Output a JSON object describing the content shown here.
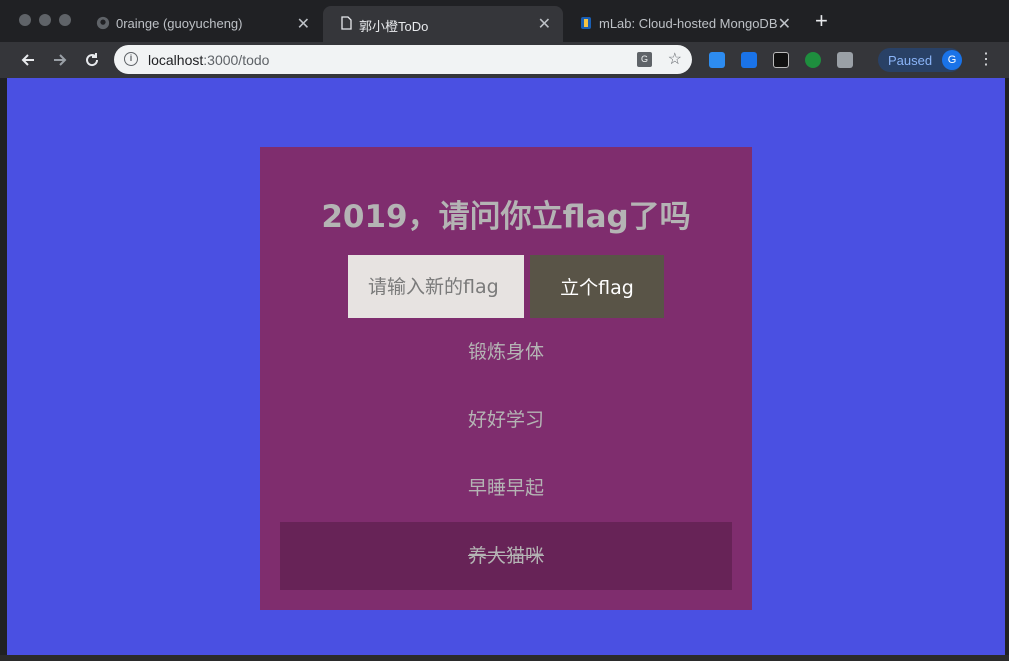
{
  "browser": {
    "tabs": [
      {
        "title": "0rainge (guoyucheng)",
        "active": false,
        "favicon": "github-icon"
      },
      {
        "title": "郭小橙ToDo",
        "active": true,
        "favicon": "document-icon"
      },
      {
        "title": "mLab: Cloud-hosted MongoDB",
        "active": false,
        "favicon": "mlab-icon"
      }
    ],
    "close_glyph": "✕",
    "new_tab_glyph": "+",
    "url_host": "localhost",
    "url_path": ":3000/todo",
    "profile_status": "Paused",
    "profile_initial": "G"
  },
  "page": {
    "heading": "2019，请问你立flag了吗",
    "input_placeholder": "请输入新的flag",
    "add_button": "立个flag",
    "todos": [
      {
        "text": "锻炼身体",
        "done": false
      },
      {
        "text": "好好学习",
        "done": false
      },
      {
        "text": "早睡早起",
        "done": false
      },
      {
        "text": "养大猫咪",
        "done": true
      }
    ]
  },
  "colors": {
    "page_background": "#4a50e2",
    "card_background": "#7f2d6e",
    "done_row_background": "#672357",
    "button_background": "#595447",
    "input_background": "#e7e3e1"
  }
}
